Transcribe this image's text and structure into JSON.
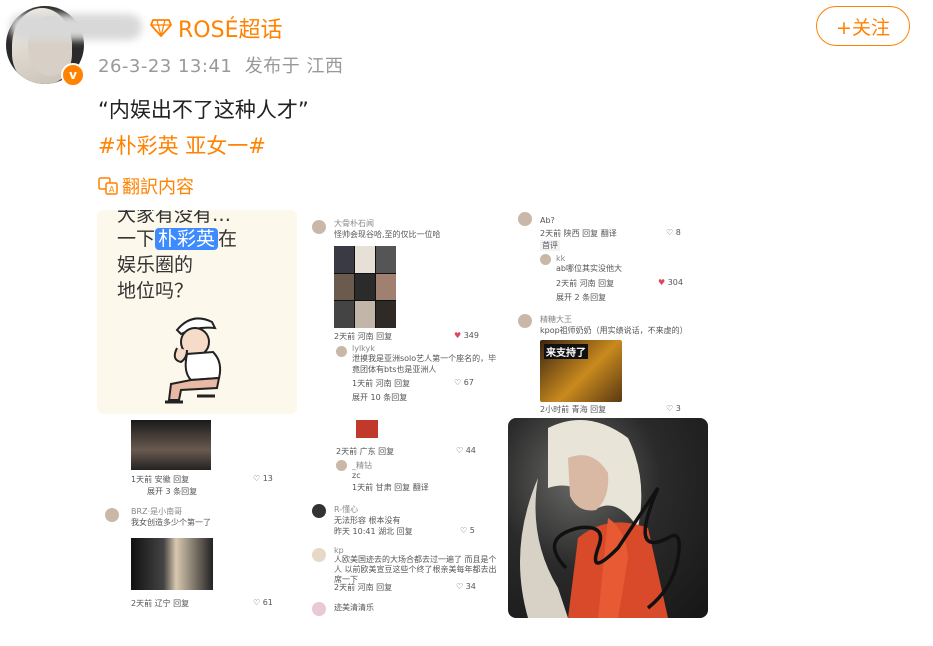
{
  "header": {
    "topic_label": "ROSÉ超话",
    "meta": "26-3-23 13:41  发布于 江西",
    "follow_label": "+关注"
  },
  "post": {
    "text": "“内娱出不了这种人才”",
    "tags": "#朴彩英 亚女一#",
    "translate_label": "翻訳内容"
  },
  "img1": {
    "line0": "大家有没有…",
    "line1_pre": "一下",
    "line1_hl": "朴彩英",
    "line1_post": "在",
    "line2": "娱乐圈的",
    "line3": "地位吗？"
  },
  "img2": {
    "c1_name": "大骨朴石闻",
    "c1_text": "怪帅会现谷哈,至的仅比一位哈",
    "c1_foot": "2天前 河南  回复",
    "c1_likes": "349",
    "c2_name": "lylkyk",
    "c2_text": "泄摸我是亚洲solo艺人第一个座名的，毕竟团体有bts也是亚洲人",
    "c2_foot": "1天前 河南  回复",
    "c2_likes": "67",
    "expand": "展开 10 条回复"
  },
  "img3": {
    "c1_text": "Ab?",
    "c1_foot": "2天前 陕西  回复  翻译",
    "c1_likes": "8",
    "c1_badge": "首评",
    "c2_name": "kk",
    "c2_text": "ab哪位其实没他大",
    "c2_foot": "2天前 河南  回复",
    "c2_likes": "304",
    "expand": "展开 2 条回复",
    "c3_name": "精糖大王",
    "c3_text": "kpop祖师奶奶（用实绩说话，不来虚的）",
    "c3_pic": "来支持了",
    "c3_foot": "2小时前 青海  回复",
    "c3_likes": "3"
  },
  "img4": {
    "c1_foot": "1天前 安徽  回复",
    "c1_likes": "13",
    "expand": "展开 3 条回复",
    "c2_name": "BRZ·是小南哥",
    "c2_text": "我女创造多少个第一了",
    "c2_foot": "2天前 辽宁  回复",
    "c2_likes": "61"
  },
  "img5": {
    "c1_foot": "2天前 广东  回复",
    "c1_likes": "44",
    "c2_name": "_精钻",
    "c2_text": "zc",
    "c2_foot": "1天前 甘肃  回复  翻译",
    "c3_name": "R-懂心",
    "c3_text": "无法形容 根本没有",
    "c3_foot": "昨天 10:41 湖北  回复",
    "c3_likes": "5",
    "c4_name": "kp",
    "c4_text": "人欧美国迹去的大场合都去过一遍了 而且是个人 以前欧美宣豆这些个终了根亲美每年都去出席一下",
    "c4_foot": "2天前 河南  回复",
    "c4_likes": "34",
    "c5_name": "迹美清清乐"
  },
  "img6": {
    "signature": "Ch"
  },
  "colors": {
    "accent": "#ff8200",
    "like": "#e0475e",
    "highlight": "#3d8bff"
  }
}
